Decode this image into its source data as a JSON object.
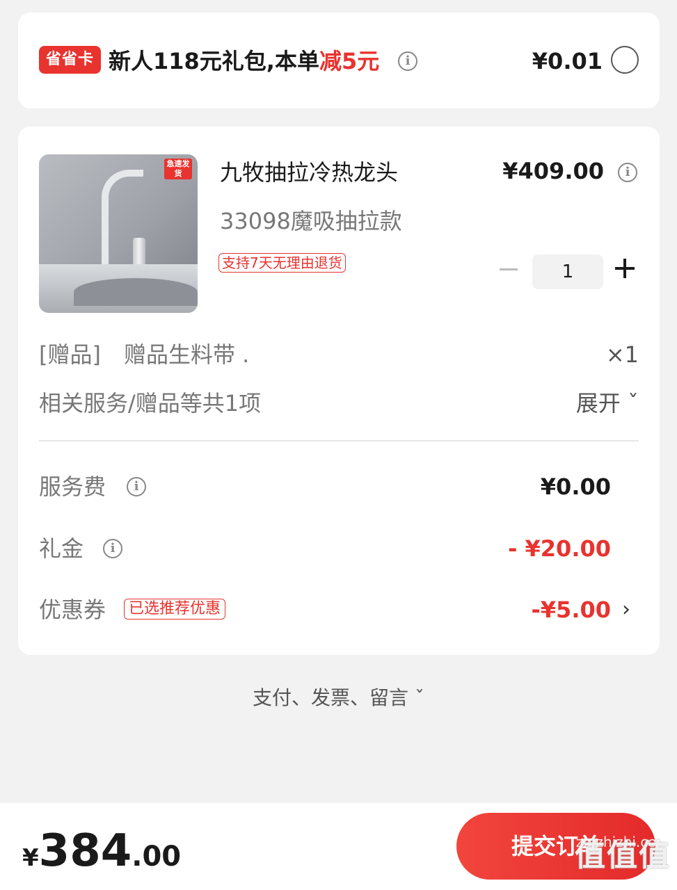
{
  "promo": {
    "badge": "省省卡",
    "text_prefix": "新人118元礼包,本单",
    "text_highlight": "减5元",
    "price": "¥0.01"
  },
  "product": {
    "image_tag": "急速发货",
    "title": "九牧抽拉冷热龙头",
    "spec": "33098魔吸抽拉款",
    "return_tag": "支持7天无理由退货",
    "price": "¥409.00",
    "quantity": "1"
  },
  "gift": {
    "tag": "[赠品]",
    "name": "赠品生料带 .",
    "count": "×1"
  },
  "services": {
    "label": "相关服务/赠品等共1项",
    "expand": "展开 ˇ"
  },
  "fees": {
    "service_fee_label": "服务费",
    "service_fee_value": "¥0.00",
    "gift_money_label": "礼金",
    "gift_money_value": "- ¥20.00",
    "coupon_label": "优惠券",
    "coupon_tag": "已选推荐优惠",
    "coupon_value": "-¥5.00"
  },
  "more_link": "支付、发票、留言 ˇ",
  "footer": {
    "currency": "¥",
    "total_int": "384",
    "total_dec": ".00",
    "submit_label": "提交订单",
    "watermark": "zhizhizhi.com",
    "watermark_logo": "值值值"
  },
  "colors": {
    "accent_red": "#e8332e",
    "background": "#f2f2f2"
  },
  "icons": [
    "info-icon",
    "radio-unchecked-icon",
    "chevron-down-icon",
    "chevron-right-icon",
    "minus-icon",
    "plus-icon"
  ]
}
